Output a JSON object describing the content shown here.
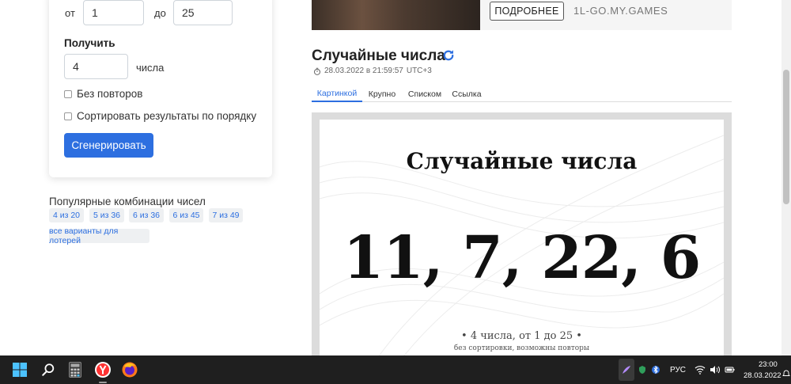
{
  "form": {
    "from_label": "от",
    "from_value": "1",
    "to_label": "до",
    "to_value": "25",
    "get_label": "Получить",
    "count_value": "4",
    "count_suffix": "числа",
    "no_repeat_label": "Без повторов",
    "sort_label": "Сортировать результаты по порядку",
    "generate_label": "Сгенерировать"
  },
  "popular": {
    "title": "Популярные комбинации чисел",
    "tags": [
      "4 из 20",
      "5 из 36",
      "6 из 36",
      "6 из 45",
      "7 из 49"
    ],
    "all_lotteries": "все варианты для лотерей"
  },
  "banner": {
    "button": "ПОДРОБНЕЕ",
    "url": "1L-GO.MY.GAMES"
  },
  "result": {
    "title": "Случайные числа",
    "date": "28.03.2022 в 21:59:57",
    "tz": "UTC+3",
    "tabs": [
      "Картинкой",
      "Крупно",
      "Списком",
      "Ссылка"
    ],
    "active_tab": "Картинкой"
  },
  "image": {
    "title": "Случайные числа",
    "numbers": "11, 7, 22, 6",
    "subtitle": "• 4 числа, от 1 до 25 •",
    "note": "без сортировки, возможны повторы"
  },
  "taskbar": {
    "lang": "РУС",
    "time": "23:00",
    "date": "28.03.2022"
  },
  "colors": {
    "accent": "#2d6fe0",
    "taskbar": "#1f1f1f"
  }
}
